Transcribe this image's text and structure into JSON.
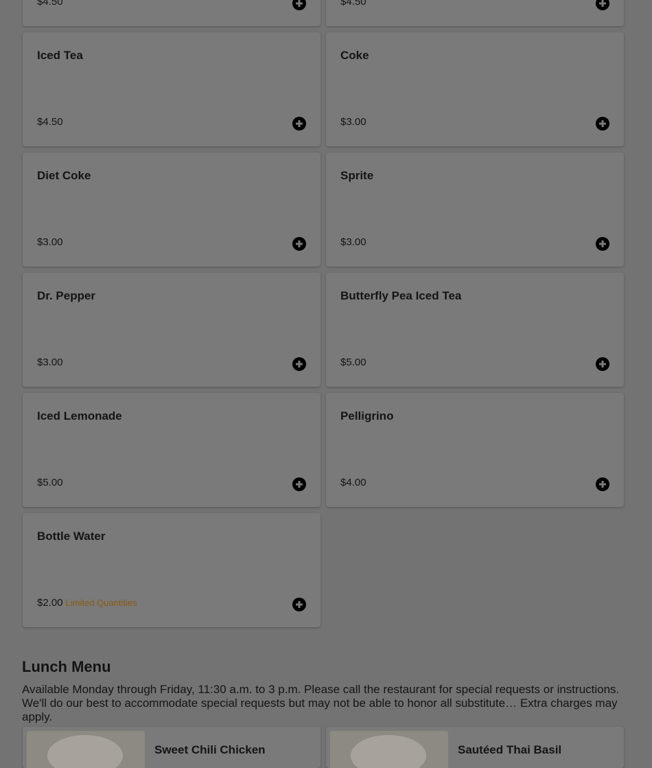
{
  "colors": {
    "overlay_background": "#737373",
    "card_background": "#7a7a7a",
    "badge_text": "#8a5a0f",
    "icon": "#000000"
  },
  "top_partial": {
    "left": {
      "price": "$4.50"
    },
    "right": {
      "price": "$4.50"
    }
  },
  "drinks": [
    {
      "name": "Iced Tea",
      "price": "$4.50"
    },
    {
      "name": "Coke",
      "price": "$3.00"
    },
    {
      "name": "Diet Coke",
      "price": "$3.00"
    },
    {
      "name": "Sprite",
      "price": "$3.00"
    },
    {
      "name": "Dr. Pepper",
      "price": "$3.00"
    },
    {
      "name": "Butterfly Pea Iced Tea",
      "price": "$5.00"
    },
    {
      "name": "Iced Lemonade",
      "price": "$5.00"
    },
    {
      "name": "Pelligrino",
      "price": "$4.00"
    },
    {
      "name": "Bottle Water",
      "price": "$2.00",
      "badge": "Limited Quantities"
    }
  ],
  "add_icon": "plus-circle-icon",
  "lunch": {
    "title": "Lunch Menu",
    "description": "Available Monday through Friday, 11:30 a.m. to 3 p.m. Please call the restaurant for special requests or instructions. We'll do our best to accommodate special requests but may not be able to honor all substitute… Extra charges may apply.",
    "items": [
      {
        "name": "Sweet Chili Chicken"
      },
      {
        "name": "Sautéed Thai Basil"
      }
    ]
  }
}
